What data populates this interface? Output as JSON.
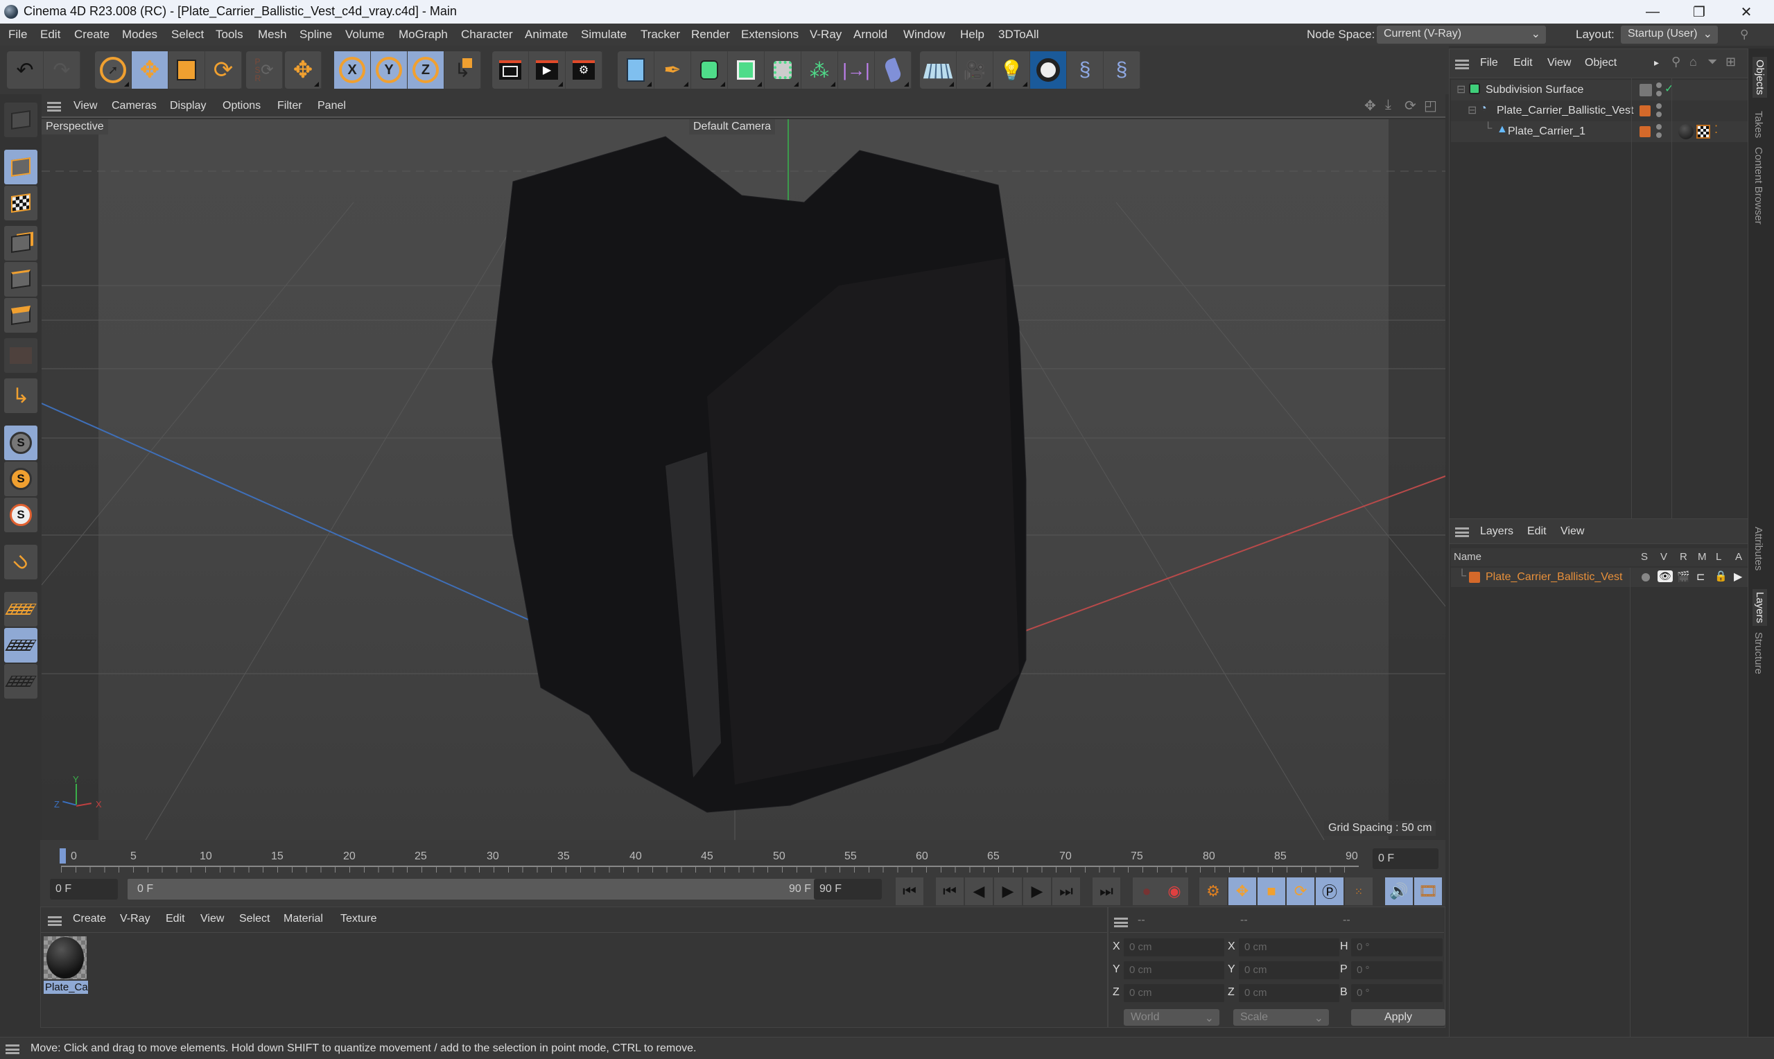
{
  "window": {
    "title": "Cinema 4D R23.008 (RC) - [Plate_Carrier_Ballistic_Vest_c4d_vray.c4d] - Main",
    "controls": {
      "minimize": "—",
      "restore": "❐",
      "close": "✕"
    }
  },
  "menubar": {
    "items": [
      "File",
      "Edit",
      "Create",
      "Modes",
      "Select",
      "Tools",
      "Mesh",
      "Spline",
      "Volume",
      "MoGraph",
      "Character",
      "Animate",
      "Simulate",
      "Tracker",
      "Render",
      "Extensions",
      "V-Ray",
      "Arnold",
      "Window",
      "Help",
      "3DToAll"
    ],
    "node_space_label": "Node Space:",
    "node_space_value": "Current (V-Ray)",
    "layout_label": "Layout:",
    "layout_value": "Startup (User)"
  },
  "toolbar": {
    "groups": [
      [
        "undo-icon",
        "redo-icon"
      ],
      [
        "live-selection-icon",
        "move-icon",
        "scale-icon",
        "rotate-icon"
      ],
      [
        "psr-icon"
      ],
      [
        "transform-icon"
      ],
      [
        "x-axis-lock-icon",
        "y-axis-lock-icon",
        "z-axis-lock-icon",
        "coordinate-system-icon"
      ],
      [
        "render-view-icon",
        "render-picture-viewer-icon",
        "render-settings-icon"
      ],
      [
        "cube-primitive-icon",
        "pen-spline-icon",
        "subdivision-surface-icon",
        "extrude-icon",
        "array-icon",
        "cloner-icon",
        "symmetry-icon",
        "bend-deformer-icon"
      ],
      [
        "floor-icon",
        "camera-icon",
        "light-icon",
        "vray-icon",
        "python-icon",
        "python-icon"
      ]
    ],
    "axis_labels": [
      "X",
      "Y",
      "Z"
    ]
  },
  "left_tools": [
    "make-editable-icon",
    "model-mode-icon",
    "texture-mode-icon",
    "point-mode-icon",
    "edge-mode-icon",
    "polygon-mode-icon",
    "uv-mode-icon",
    "axis-mode-icon",
    "solo-icon",
    "solo-hierarchy-icon",
    "solo-selection-icon",
    "snap-icon",
    "workplane-icon",
    "locked-workplane-icon",
    "align-workplane-icon"
  ],
  "viewport": {
    "menu": [
      "View",
      "Cameras",
      "Display",
      "Options",
      "Filter",
      "Panel"
    ],
    "view_label": "Perspective",
    "camera_label": "Default Camera",
    "grid_spacing": "Grid Spacing : 50 cm",
    "axis": {
      "x": "X",
      "y": "Y",
      "z": "Z"
    }
  },
  "timeline": {
    "ticks": [
      "0",
      "5",
      "10",
      "15",
      "20",
      "25",
      "30",
      "35",
      "40",
      "45",
      "50",
      "55",
      "60",
      "65",
      "70",
      "75",
      "80",
      "85",
      "90"
    ],
    "current_frame": "0 F",
    "start_field": "0 F",
    "range_start": "0 F",
    "range_end": "90 F",
    "end_field": "90 F"
  },
  "material_manager": {
    "menu": [
      "Create",
      "V-Ray",
      "Edit",
      "View",
      "Select",
      "Material",
      "Texture"
    ],
    "materials": [
      {
        "name": "Plate_Ca"
      }
    ]
  },
  "coordinates": {
    "headers": [
      "--",
      "--",
      "--"
    ],
    "rows": [
      {
        "pos_label": "X",
        "pos": "0 cm",
        "size_label": "X",
        "size": "0 cm",
        "rot_label": "H",
        "rot": "0 °"
      },
      {
        "pos_label": "Y",
        "pos": "0 cm",
        "size_label": "Y",
        "size": "0 cm",
        "rot_label": "P",
        "rot": "0 °"
      },
      {
        "pos_label": "Z",
        "pos": "0 cm",
        "size_label": "Z",
        "size": "0 cm",
        "rot_label": "B",
        "rot": "0 °"
      }
    ],
    "space": "World",
    "mode": "Scale",
    "apply": "Apply"
  },
  "object_manager": {
    "menu": [
      "File",
      "Edit",
      "View",
      "Object"
    ],
    "objects": [
      {
        "name": "Subdivision Surface",
        "depth": 0
      },
      {
        "name": "Plate_Carrier_Ballistic_Vest",
        "depth": 1
      },
      {
        "name": "Plate_Carrier_1",
        "depth": 2
      }
    ]
  },
  "layer_manager": {
    "menu": [
      "Layers",
      "Edit",
      "View"
    ],
    "columns": [
      "Name",
      "S",
      "V",
      "R",
      "M",
      "L",
      "A"
    ],
    "layers": [
      {
        "name": "Plate_Carrier_Ballistic_Vest",
        "color": "#d4692a"
      }
    ]
  },
  "side_tabs": {
    "top": [
      "Objects",
      "Takes",
      "Content Browser"
    ],
    "bottom": [
      "Attributes",
      "Layers",
      "Structure"
    ]
  },
  "status": "Move: Click and drag to move elements. Hold down SHIFT to quantize movement / add to the selection in point mode, CTRL to remove.",
  "colors": {
    "accent": "#f0a030",
    "selected": "#8fa9d4",
    "layer": "#d4692a"
  }
}
